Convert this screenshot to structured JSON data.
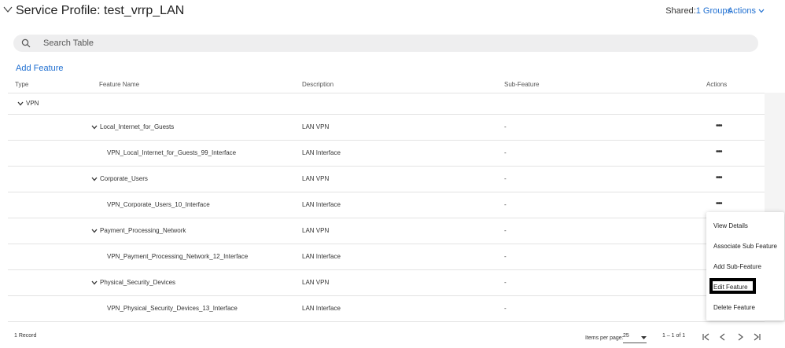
{
  "header": {
    "title": "Service Profile: test_vrrp_LAN",
    "shared_label": "Shared:",
    "shared_link": "1 Groups",
    "actions_label": "Actions"
  },
  "search": {
    "placeholder": "Search Table"
  },
  "toolbar": {
    "add_feature": "Add Feature"
  },
  "table": {
    "columns": {
      "type": "Type",
      "feature": "Feature Name",
      "description": "Description",
      "sub": "Sub-Feature",
      "actions": "Actions"
    },
    "group_label": "VPN",
    "rows": [
      {
        "name": "Local_Internet_for_Guests",
        "description": "LAN VPN",
        "sub": "-"
      },
      {
        "name": "VPN_Local_Internet_for_Guests_99_Interface",
        "description": "LAN Interface",
        "sub": "-"
      },
      {
        "name": "Corporate_Users",
        "description": "LAN VPN",
        "sub": "-"
      },
      {
        "name": "VPN_Corporate_Users_10_Interface",
        "description": "LAN Interface",
        "sub": "-"
      },
      {
        "name": "Payment_Processing_Network",
        "description": "LAN VPN",
        "sub": "-"
      },
      {
        "name": "VPN_Payment_Processing_Network_12_Interface",
        "description": "LAN Interface",
        "sub": "-"
      },
      {
        "name": "Physical_Security_Devices",
        "description": "LAN VPN",
        "sub": "-"
      },
      {
        "name": "VPN_Physical_Security_Devices_13_Interface",
        "description": "LAN Interface",
        "sub": "-"
      }
    ],
    "row_action": "•••"
  },
  "menu": {
    "items": [
      "View Details",
      "Associate Sub Feature",
      "Add Sub-Feature",
      "Edit Feature",
      "Delete Feature"
    ]
  },
  "footer": {
    "records": "1 Record",
    "items_per_page_label": "Items per page:",
    "items_per_page_value": "25",
    "range": "1 – 1 of 1"
  },
  "colors": {
    "link": "#1f6fd1",
    "highlight_border": "#000000"
  }
}
